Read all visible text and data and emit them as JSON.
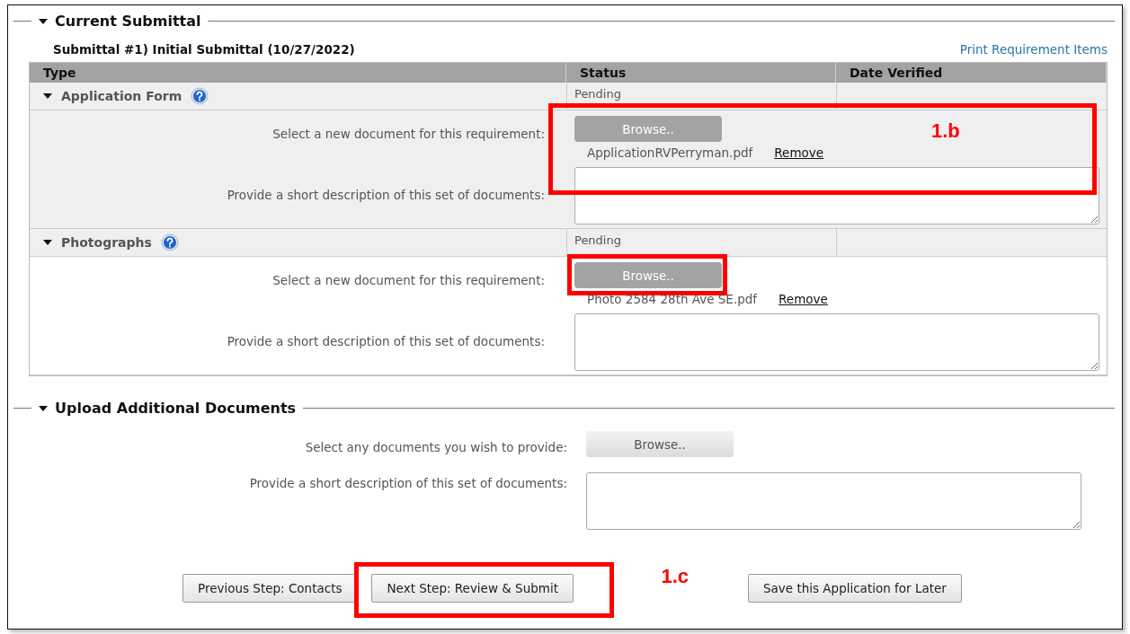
{
  "current_submittal": {
    "legend": "Current Submittal",
    "expanded": true,
    "submittal_title": "Submittal #1) Initial Submittal (10/27/2022)",
    "print_link": "Print Requirement Items",
    "columns": [
      "Type",
      "Status",
      "Date Verified"
    ],
    "requirements": [
      {
        "type": "Application Form",
        "status": "Pending",
        "expanded": true,
        "shaded": true,
        "select_label": "Select a new document for this requirement:",
        "browse": "Browse..",
        "file": "ApplicationRVPerryman.pdf",
        "remove": "Remove",
        "description_label": "Provide a short description of this set of documents:",
        "browse_boxed": false,
        "callout": {
          "label": "1.b"
        }
      },
      {
        "type": "Photographs",
        "status": "Pending",
        "expanded": true,
        "shaded": false,
        "select_label": "Select a new document for this requirement:",
        "browse": "Browse..",
        "file": "Photo 2584 28th Ave SE.pdf",
        "remove": "Remove",
        "description_label": "Provide a short description of this set of documents:",
        "browse_boxed": true
      }
    ]
  },
  "additional": {
    "legend": "Upload Additional Documents",
    "expanded": true,
    "select_label": "Select any documents you wish to provide:",
    "browse": "Browse..",
    "description_label": "Provide a short description of this set of documents:"
  },
  "buttons": [
    {
      "label": "Previous Step: Contacts"
    },
    {
      "label": "Next Step: Review & Submit",
      "callout": "1.c"
    },
    {
      "label": "Save this Application for Later"
    }
  ]
}
